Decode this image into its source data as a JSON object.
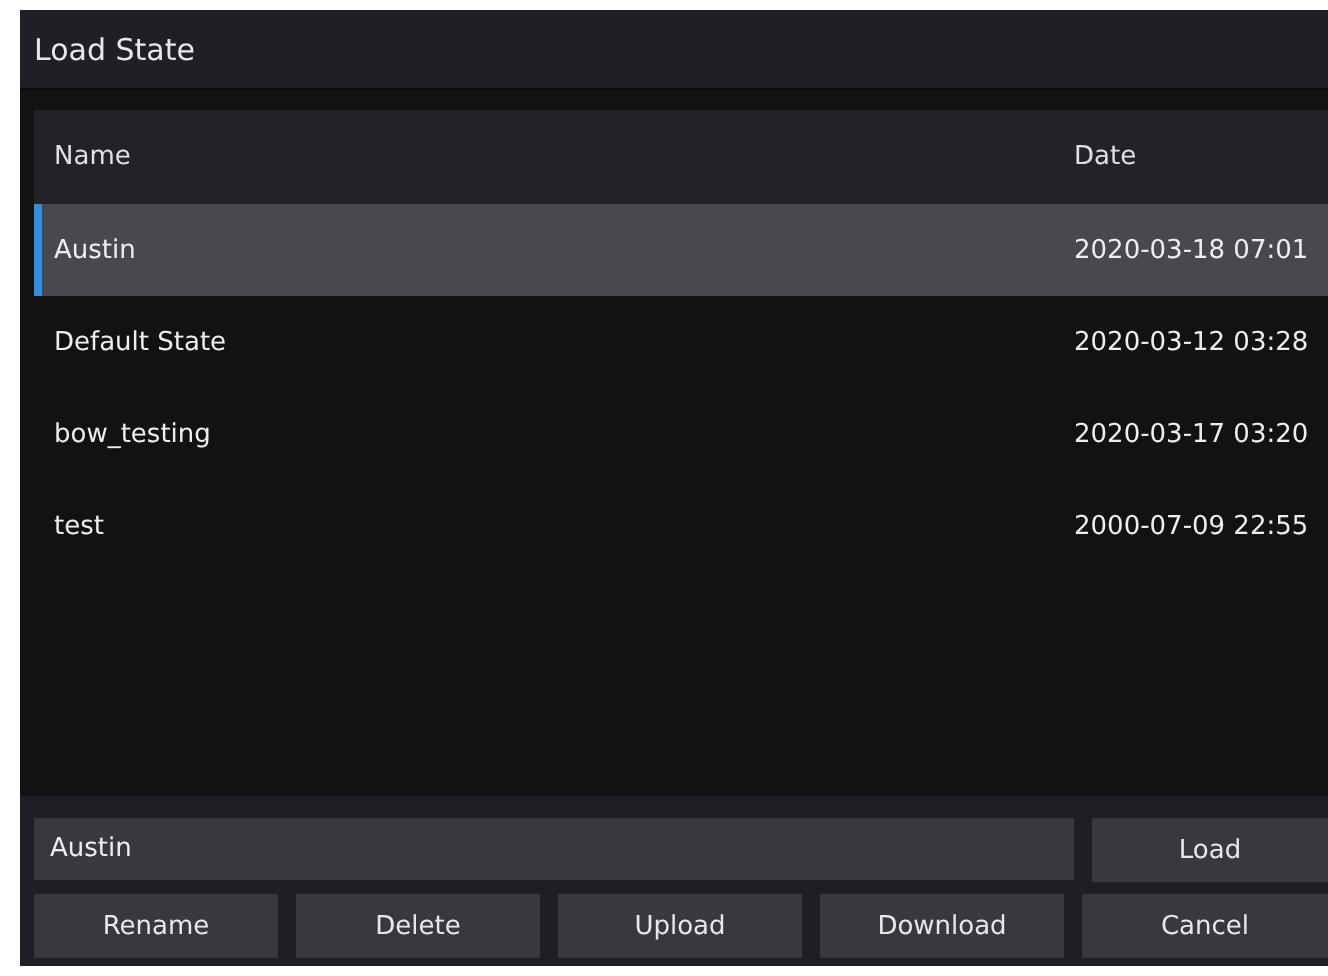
{
  "window": {
    "title": "Load State"
  },
  "table": {
    "columns": [
      "Name",
      "Date"
    ],
    "rows": [
      {
        "name": "Austin",
        "date": "2020-03-18 07:01",
        "selected": true
      },
      {
        "name": "Default State",
        "date": "2020-03-12 03:28",
        "selected": false
      },
      {
        "name": "bow_testing",
        "date": "2020-03-17 03:20",
        "selected": false
      },
      {
        "name": "test",
        "date": "2000-07-09 22:55",
        "selected": false
      }
    ]
  },
  "name_field": {
    "value": "Austin"
  },
  "buttons": [
    "Load",
    "Rename",
    "Delete",
    "Upload",
    "Download",
    "Cancel"
  ]
}
